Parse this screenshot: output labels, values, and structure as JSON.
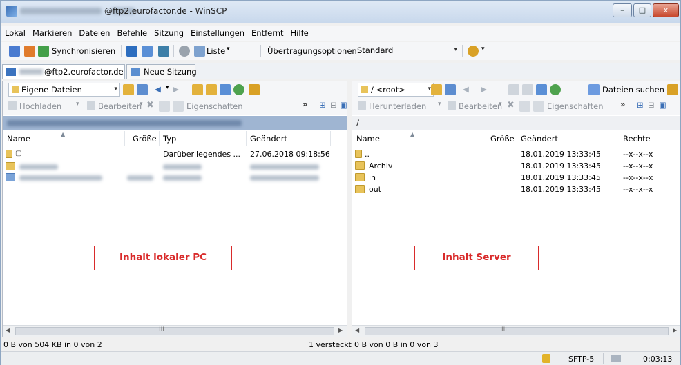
{
  "window": {
    "title": "@ftp2.eurofactor.de - WinSCP",
    "buttons": {
      "minimize": "–",
      "maximize": "□",
      "close": "x"
    }
  },
  "menu": [
    "Lokal",
    "Markieren",
    "Dateien",
    "Befehle",
    "Sitzung",
    "Einstellungen",
    "Entfernt",
    "Hilfe"
  ],
  "toolbar": {
    "sync_label": "Synchronisieren",
    "list_label": "Liste",
    "transfer_label": "Übertragungsoptionen",
    "transfer_value": "Standard"
  },
  "tabs": [
    {
      "label": "@ftp2.eurofactor.de"
    },
    {
      "label": "Neue Sitzung"
    }
  ],
  "left_pane": {
    "location_combo": "Eigene Dateien",
    "actions": {
      "upload": "Hochladen",
      "edit": "Bearbeiten",
      "properties": "Eigenschaften"
    },
    "columns": {
      "name": "Name",
      "size": "Größe",
      "type": "Typ",
      "changed": "Geändert"
    },
    "rows": [
      {
        "name": "",
        "size": "",
        "type": "Darüberliegendes ...",
        "changed": "27.06.2018 09:18:56"
      }
    ],
    "annotation": "Inhalt lokaler PC",
    "scroll_middle": "III"
  },
  "right_pane": {
    "location_combo": "/ <root>",
    "find_label": "Dateien suchen",
    "actions": {
      "download": "Herunterladen",
      "edit": "Bearbeiten",
      "properties": "Eigenschaften"
    },
    "path": "/",
    "columns": {
      "name": "Name",
      "size": "Größe",
      "changed": "Geändert",
      "rights": "Rechte"
    },
    "rows": [
      {
        "name": "..",
        "changed": "18.01.2019 13:33:45",
        "rights": "--x--x--x"
      },
      {
        "name": "Archiv",
        "changed": "18.01.2019 13:33:45",
        "rights": "--x--x--x"
      },
      {
        "name": "in",
        "changed": "18.01.2019 13:33:45",
        "rights": "--x--x--x"
      },
      {
        "name": "out",
        "changed": "18.01.2019 13:33:45",
        "rights": "--x--x--x"
      }
    ],
    "annotation": "Inhalt Server",
    "scroll_middle": "III"
  },
  "status": {
    "left": "0 B von 504 KB in 0 von 2",
    "hidden": "1 versteckt",
    "right": "0 B von 0 B in 0 von 3",
    "protocol": "SFTP-5",
    "elapsed": "0:03:13"
  }
}
